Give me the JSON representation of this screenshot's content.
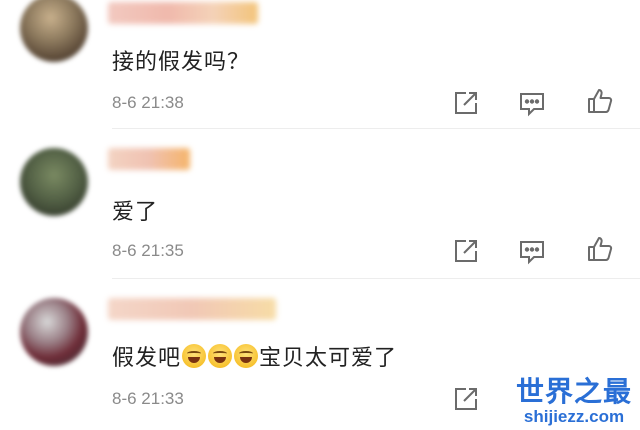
{
  "comments": [
    {
      "text": "接的假发吗？",
      "time": "8-6 21:38"
    },
    {
      "text": "爱了",
      "time": "8-6 21:35"
    },
    {
      "text_before": "假发吧",
      "emojis": [
        "laugh-cry-emoji",
        "laugh-cry-emoji",
        "laugh-cry-emoji"
      ],
      "text_after": "宝贝太可爱了",
      "time": "8-6 21:33"
    }
  ],
  "icons": {
    "share": "share-icon",
    "reply": "comment-icon",
    "like": "thumbs-up-icon"
  },
  "colors": {
    "icon_stroke": "#6b6b6b",
    "time_text": "#8a8a8a",
    "watermark": "#2a6fd6"
  },
  "watermark": {
    "title": "世界之最",
    "url": "shijiezz.com"
  }
}
